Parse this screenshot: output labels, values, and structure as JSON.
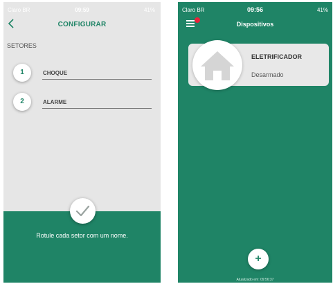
{
  "left_screen": {
    "status_bar": {
      "carrier": "Claro BR",
      "time": "09:59",
      "battery": "41%"
    },
    "header": {
      "back_icon": "chevron-left-icon",
      "title": "CONFIGURAR"
    },
    "section_label": "SETORES",
    "sectors": [
      {
        "number": "1",
        "label": "CHOQUE"
      },
      {
        "number": "2",
        "label": "ALARME"
      }
    ],
    "confirm_icon": "check-icon",
    "hint": "Rotule cada setor com um nome."
  },
  "right_screen": {
    "status_bar": {
      "carrier": "Claro BR",
      "time": "09:56",
      "battery": "41%"
    },
    "header": {
      "menu_icon": "hamburger-icon",
      "title": "Dispositivos"
    },
    "devices": [
      {
        "icon": "house-icon",
        "name": "ELETRIFICADOR",
        "state": "Desarmado"
      }
    ],
    "add_icon": "plus-icon",
    "add_label": "+",
    "updated": "Atualizado em: 09:56:37"
  },
  "colors": {
    "green": "#1f8466",
    "gray_bg": "#e6e6e6",
    "notif": "#e8223a"
  }
}
